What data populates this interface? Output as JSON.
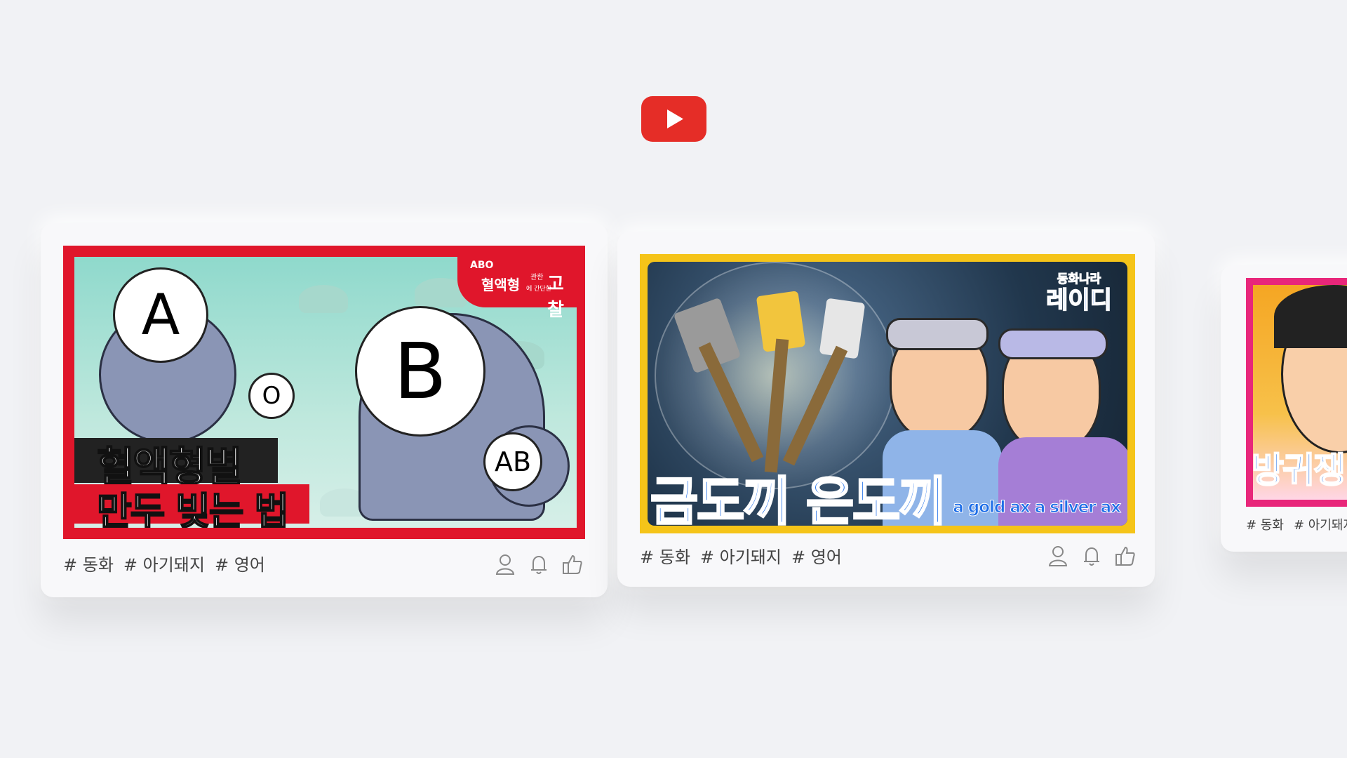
{
  "logo": {
    "name": "YouTube",
    "icon": "play-icon",
    "color": "#e52d27"
  },
  "cards": [
    {
      "thumb": {
        "title_line1": "혈액형별",
        "title_line2": "만두 빚는 법",
        "badge_top": "ABO",
        "badge_main": "혈액형",
        "badge_small1": "관한",
        "badge_small2": "에 간단한",
        "badge_end": "고찰",
        "circle_a": "A",
        "circle_b": "B",
        "circle_o": "O",
        "circle_ab": "AB",
        "border_color": "#e0162b"
      },
      "tags": [
        "# 동화",
        "# 아기돼지",
        "# 영어"
      ]
    },
    {
      "thumb": {
        "title_ko": "금도끼 은도끼",
        "title_en": "a gold ax a silver ax",
        "badge_line1": "동화나라",
        "badge_line2": "레이디",
        "border_color": "#f5c419"
      },
      "tags": [
        "# 동화",
        "# 아기돼지",
        "# 영어"
      ]
    },
    {
      "thumb": {
        "title_partial": "방귀쟁",
        "border_color": "#e8267a"
      },
      "tags": [
        "# 동화",
        "# 아기돼지"
      ]
    }
  ],
  "actions": {
    "icons": [
      "user-icon",
      "bell-icon",
      "thumbs-up-icon"
    ]
  }
}
